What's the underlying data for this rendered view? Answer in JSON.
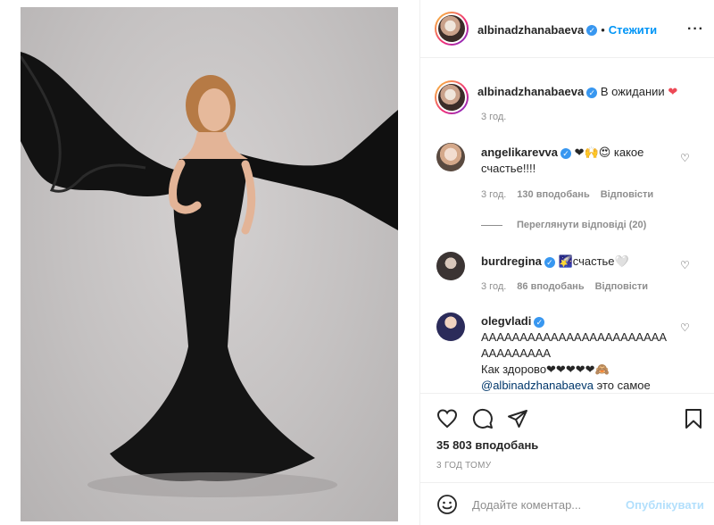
{
  "header": {
    "username": "albinadzhanabaeva",
    "separator": "•",
    "follow_label": "Стежити",
    "more": "···"
  },
  "caption": {
    "username": "albinadzhanabaeva",
    "text": "В ожидании",
    "emoji": "❤",
    "time": "3 год."
  },
  "comments": [
    {
      "username": "angelikarevva",
      "text_line1": "❤🙌😍 какое",
      "text_line2": "счастье!!!!",
      "time": "3 год.",
      "likes": "130 вподобань",
      "reply": "Відповісти",
      "view_replies": "Переглянути відповіді (20)"
    },
    {
      "username": "burdregina",
      "text_line1": "🌠счастье🤍",
      "time": "3 год.",
      "likes": "86 вподобань",
      "reply": "Відповісти"
    },
    {
      "username": "olegvladi",
      "text_line1": "АААААААААААААААААААААААА",
      "text_line2": "ААААААААА",
      "text_line3": "Как здорово❤❤❤❤❤🙈",
      "mention": "@albinadzhanabaeva",
      "text_line4": "это самое"
    }
  ],
  "actions": {
    "likes": "35 803 вподобань",
    "time_ago": "3 ГОД ТОМУ"
  },
  "comment_input": {
    "placeholder": "Додайте коментар...",
    "post_label": "Опублікувати"
  },
  "colors": {
    "accent": "#0095f6",
    "verified": "#3897f0",
    "heart": "#ed4956",
    "muted": "#8e8e8e"
  },
  "icons": [
    "heart-icon",
    "comment-icon",
    "share-icon",
    "bookmark-icon",
    "emoji-icon",
    "verified-icon",
    "more-icon"
  ]
}
